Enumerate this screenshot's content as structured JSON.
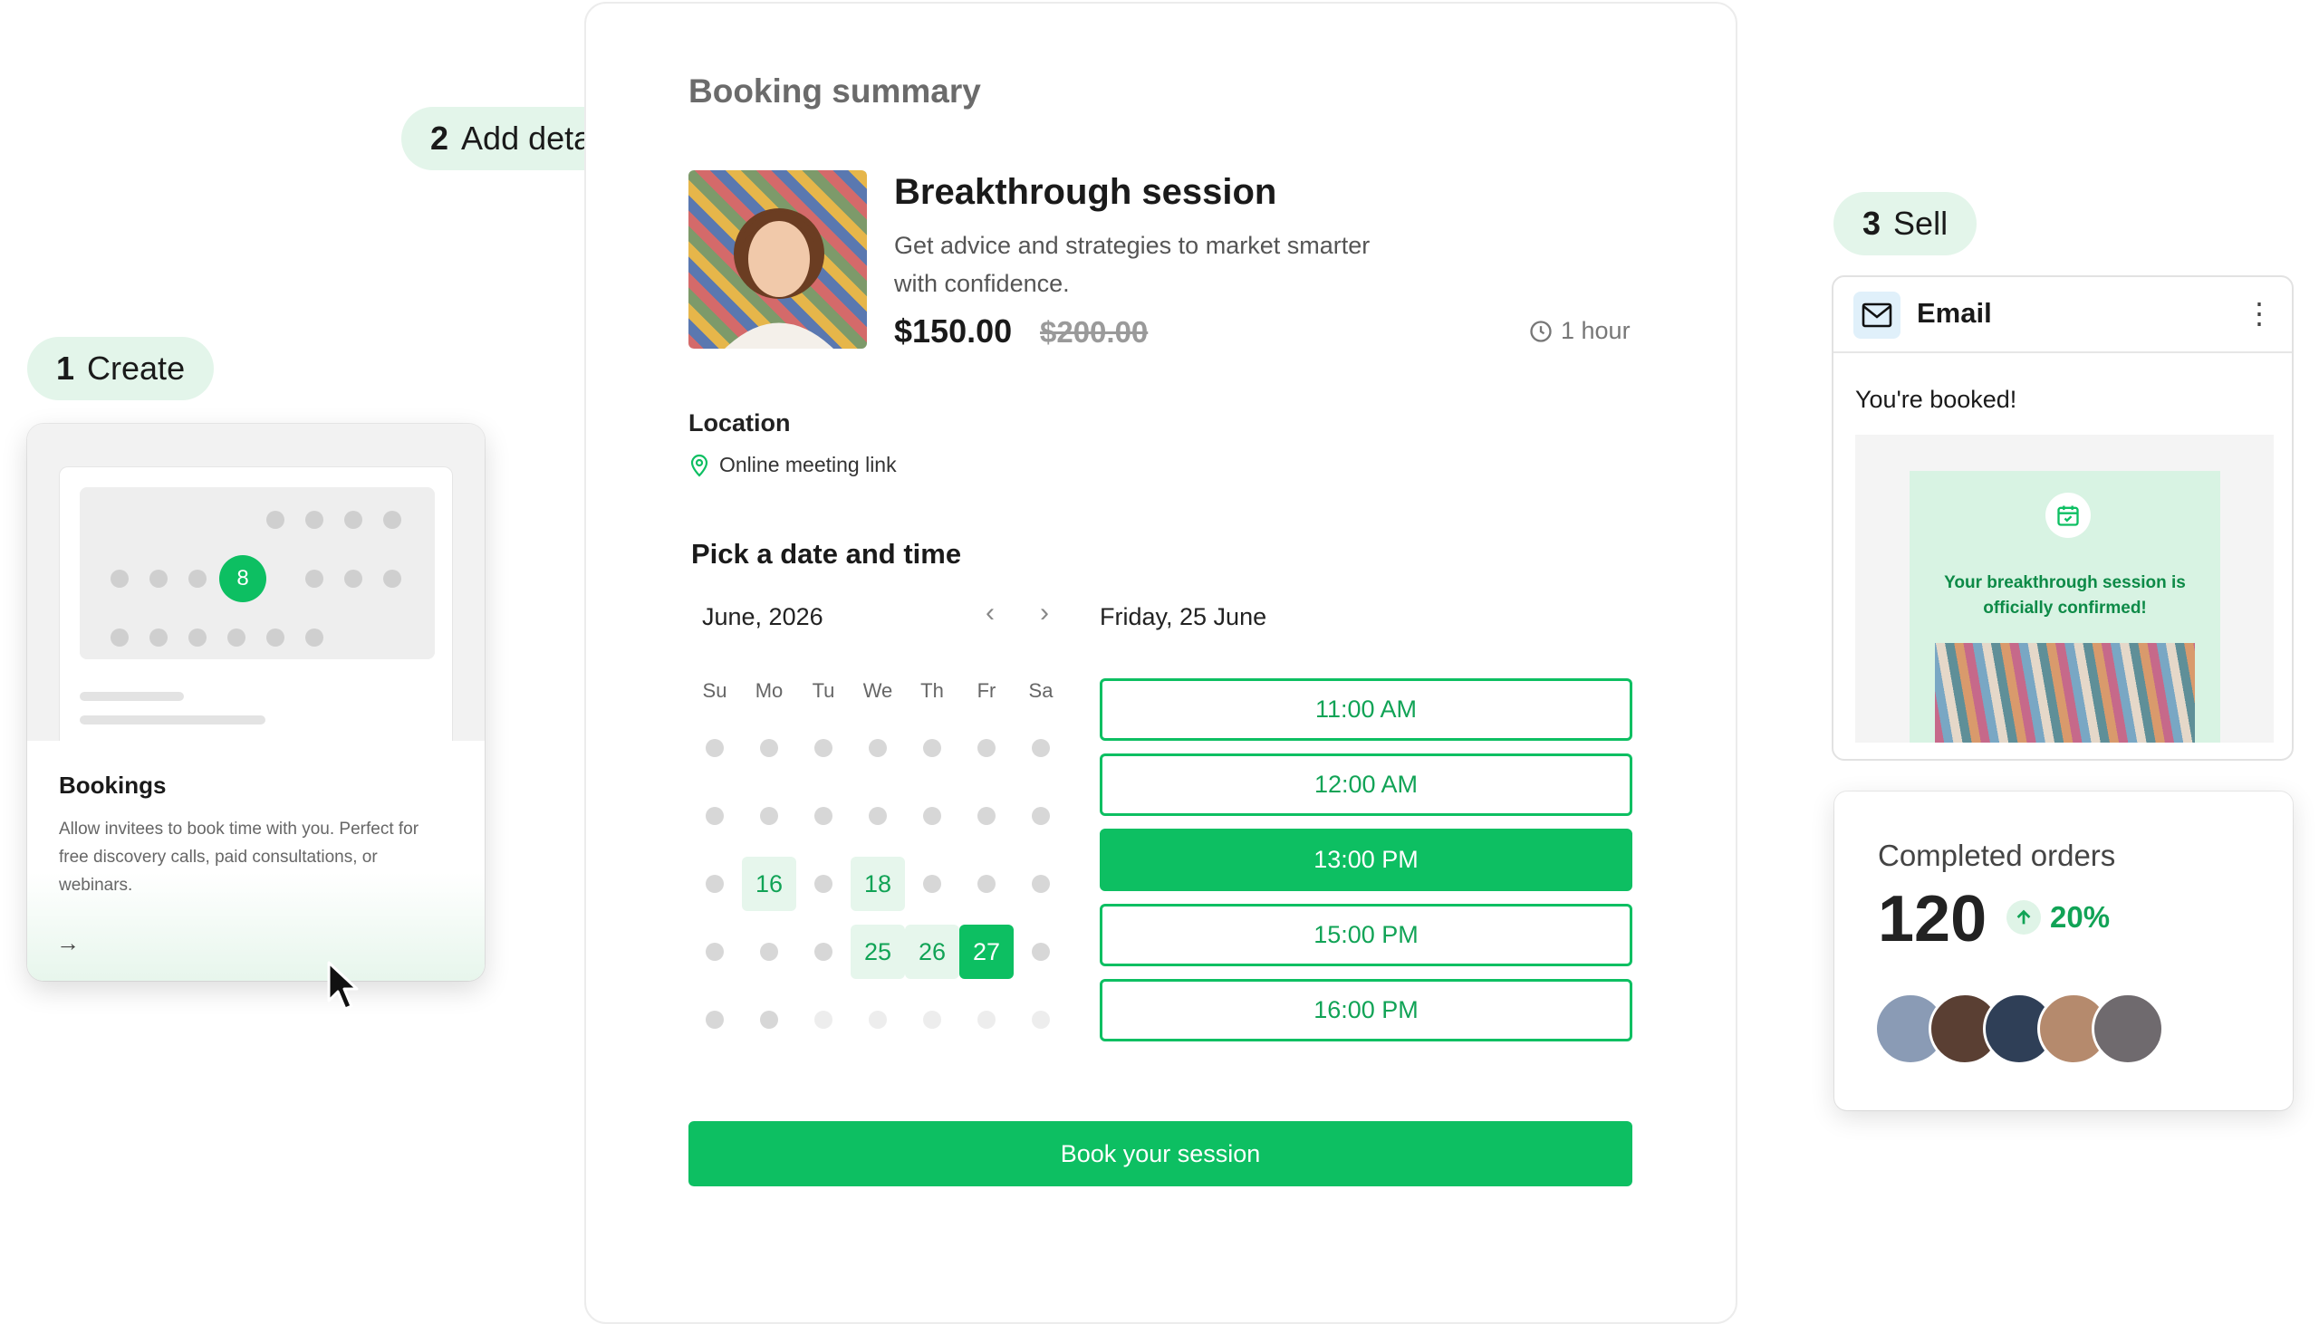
{
  "steps": {
    "create": {
      "num": "1",
      "label": "Create"
    },
    "add_details": {
      "num": "2",
      "label": "Add details"
    },
    "sell": {
      "num": "3",
      "label": "Sell"
    }
  },
  "create_card": {
    "selected_day": "8",
    "title": "Bookings",
    "description": "Allow invitees to book time with you. Perfect for free discovery calls, paid consultations, or webinars.",
    "arrow": "→"
  },
  "summary": {
    "heading": "Booking summary",
    "session_title": "Breakthrough session",
    "session_desc": "Get advice and strategies to market smarter with confidence.",
    "price": "$150.00",
    "old_price": "$200.00",
    "duration": "1 hour",
    "location_label": "Location",
    "location_value": "Online meeting link",
    "pick_heading": "Pick a date and time",
    "month": "June, 2026",
    "prev": "‹",
    "next": "›",
    "selected_date": "Friday, 25 June",
    "weekdays": [
      "Su",
      "Mo",
      "Tu",
      "We",
      "Th",
      "Fr",
      "Sa"
    ],
    "available_days": [
      "16",
      "18",
      "25",
      "26",
      "27"
    ],
    "selected_day": "27",
    "slots": [
      "11:00 AM",
      "12:00 AM",
      "13:00 PM",
      "15:00 PM",
      "16:00 PM"
    ],
    "selected_slot": "13:00 PM",
    "book_button": "Book your session"
  },
  "email_card": {
    "title": "Email",
    "more": "⋮",
    "subject": "You're booked!",
    "confirm_text": "Your breakthrough session is officially confirmed!"
  },
  "orders_card": {
    "label": "Completed orders",
    "value": "120",
    "change": "20%"
  },
  "colors": {
    "accent": "#0dbf62",
    "accent_light": "#e6f6ec",
    "pill_bg": "#e3f5ea"
  },
  "icons": [
    "clock-icon",
    "location-pin-icon",
    "mail-icon",
    "calendar-check-icon",
    "arrow-up-icon",
    "arrow-right-icon",
    "cursor-icon"
  ]
}
